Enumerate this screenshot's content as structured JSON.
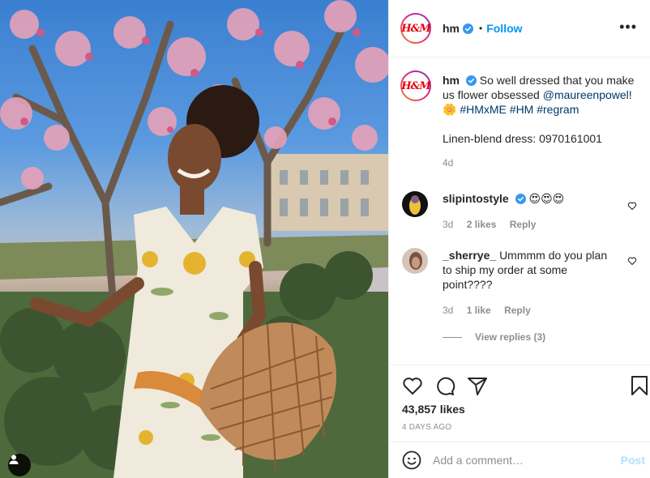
{
  "post": {
    "photo_alt": "Woman in floral dress holding woven bag under magnolia trees",
    "tag_icon": "user-tag-icon"
  },
  "header": {
    "avatar_logo": "H&M",
    "username": "hm",
    "dot": "•",
    "follow": "Follow",
    "more": "•••"
  },
  "caption": {
    "username": "hm",
    "text": "So well dressed that you make us flower obsessed",
    "mention": "@maureenpowel",
    "after_mention": "!",
    "emoji": "🌼",
    "hashtags": "#HMxME #HM #regram",
    "product": "Linen-blend dress: 0970161001",
    "age": "4d"
  },
  "comments": [
    {
      "username": "slipintostyle",
      "text": "😍😍😍",
      "age": "3d",
      "likes": "2 likes",
      "reply": "Reply",
      "verified": true
    },
    {
      "username": "_sherrye_",
      "text": "Ummmm do you plan to ship my order at some point????",
      "age": "3d",
      "likes": "1 like",
      "reply": "Reply",
      "verified": false
    }
  ],
  "view_replies": "View replies (3)",
  "likes": "43,857 likes",
  "timestamp": "4 DAYS AGO",
  "add_comment": {
    "placeholder": "Add a comment…",
    "post": "Post"
  },
  "colors": {
    "accent": "#0095f6",
    "link": "#00376b",
    "muted": "#8e8e8e",
    "brand": "#e50010"
  }
}
